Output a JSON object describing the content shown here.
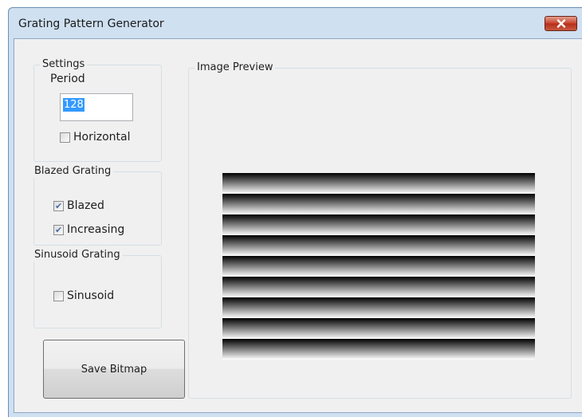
{
  "window": {
    "title": "Grating Pattern Generator",
    "close_icon": "close-icon"
  },
  "settings": {
    "group_label": "Settings",
    "period_label": "Period",
    "period_value": "128",
    "horizontal_label": "Horizontal",
    "horizontal_checked": false
  },
  "blazed": {
    "group_label": "Blazed Grating",
    "blazed_label": "Blazed",
    "blazed_checked": true,
    "increasing_label": "Increasing",
    "increasing_checked": true
  },
  "sinusoid": {
    "group_label": "Sinusoid Grating",
    "sinusoid_label": "Sinusoid",
    "sinusoid_checked": false
  },
  "save_button": {
    "label": "Save Bitmap"
  },
  "preview": {
    "group_label": "Image Preview",
    "stripe_count": 9,
    "gradient_from": "#000000",
    "gradient_to": "#ffffff"
  },
  "colors": {
    "title_bar": "#cfe0f1",
    "client_bg": "#f0f0f0",
    "selection": "#3399ff",
    "close_button": "#c8402a"
  }
}
